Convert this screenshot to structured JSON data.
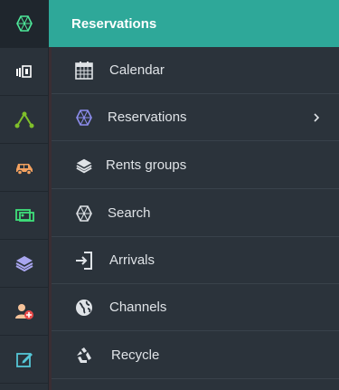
{
  "sidebar_rail": {
    "items": [
      {
        "icon": "hexagon-net-icon",
        "active": true
      },
      {
        "icon": "building-icon"
      },
      {
        "icon": "route-icon"
      },
      {
        "icon": "car-icon"
      },
      {
        "icon": "transfer-icon"
      },
      {
        "icon": "layers-icon"
      },
      {
        "icon": "user-add-icon"
      },
      {
        "icon": "edit-icon"
      }
    ]
  },
  "submenu": {
    "title": "Reservations",
    "items": [
      {
        "label": "Calendar",
        "icon": "calendar-icon"
      },
      {
        "label": "Reservations",
        "icon": "hexagon-net-icon",
        "has_submenu": true
      },
      {
        "label": "Rents groups",
        "icon": "layers-icon"
      },
      {
        "label": "Search",
        "icon": "hexagon-net-icon"
      },
      {
        "label": "Arrivals",
        "icon": "sign-in-icon"
      },
      {
        "label": "Channels",
        "icon": "globe-icon"
      },
      {
        "label": "Recycle",
        "icon": "recycle-icon"
      }
    ]
  },
  "colors": {
    "header": "#2ea899",
    "rail_bg": "#2a323a",
    "menu_bg": "#2b333b",
    "text": "#dfe3e7"
  }
}
